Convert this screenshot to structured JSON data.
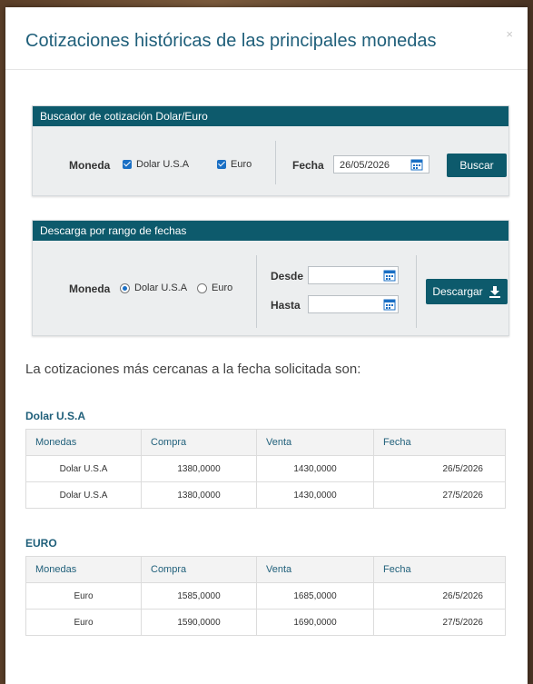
{
  "modal": {
    "title": "Cotizaciones históricas de las principales monedas",
    "close": "×"
  },
  "search_panel": {
    "header": "Buscador de cotización Dolar/Euro",
    "moneda_label": "Moneda",
    "opt_usd": "Dolar U.S.A",
    "opt_eur": "Euro",
    "usd_checked": true,
    "eur_checked": true,
    "fecha_label": "Fecha",
    "fecha_value": "26/05/2026",
    "buscar": "Buscar"
  },
  "download_panel": {
    "header": "Descarga por rango de fechas",
    "moneda_label": "Moneda",
    "opt_usd": "Dolar U.S.A",
    "opt_eur": "Euro",
    "selected": "Dolar U.S.A",
    "desde_label": "Desde",
    "hasta_label": "Hasta",
    "desde_value": "",
    "hasta_value": "",
    "descargar": "Descargar"
  },
  "results": {
    "intro": "La cotizaciones más cercanas a la fecha solicitada son:",
    "columns": [
      "Monedas",
      "Compra",
      "Venta",
      "Fecha"
    ],
    "usd": {
      "title": "Dolar U.S.A",
      "rows": [
        [
          "Dolar U.S.A",
          "1380,0000",
          "1430,0000",
          "26/5/2026"
        ],
        [
          "Dolar U.S.A",
          "1380,0000",
          "1430,0000",
          "27/5/2026"
        ]
      ]
    },
    "eur": {
      "title": "EURO",
      "rows": [
        [
          "Euro",
          "1585,0000",
          "1685,0000",
          "26/5/2026"
        ],
        [
          "Euro",
          "1590,0000",
          "1690,0000",
          "27/5/2026"
        ]
      ]
    }
  },
  "colors": {
    "accent": "#0d5a6c",
    "title": "#1f5f7a",
    "checkbox": "#1a6fc4"
  }
}
